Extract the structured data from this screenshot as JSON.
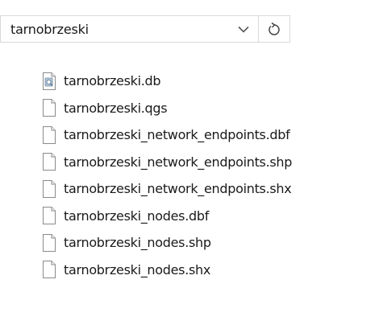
{
  "address_bar": {
    "path": "tarnobrzeski",
    "dropdown_icon": "chevron-down-icon",
    "refresh_icon": "refresh-icon"
  },
  "files": [
    {
      "name": "tarnobrzeski.db",
      "icon": "database-file-icon"
    },
    {
      "name": "tarnobrzeski.qgs",
      "icon": "blank-file-icon"
    },
    {
      "name": "tarnobrzeski_network_endpoints.dbf",
      "icon": "blank-file-icon"
    },
    {
      "name": "tarnobrzeski_network_endpoints.shp",
      "icon": "blank-file-icon"
    },
    {
      "name": "tarnobrzeski_network_endpoints.shx",
      "icon": "blank-file-icon"
    },
    {
      "name": "tarnobrzeski_nodes.dbf",
      "icon": "blank-file-icon"
    },
    {
      "name": "tarnobrzeski_nodes.shp",
      "icon": "blank-file-icon"
    },
    {
      "name": "tarnobrzeski_nodes.shx",
      "icon": "blank-file-icon"
    }
  ]
}
